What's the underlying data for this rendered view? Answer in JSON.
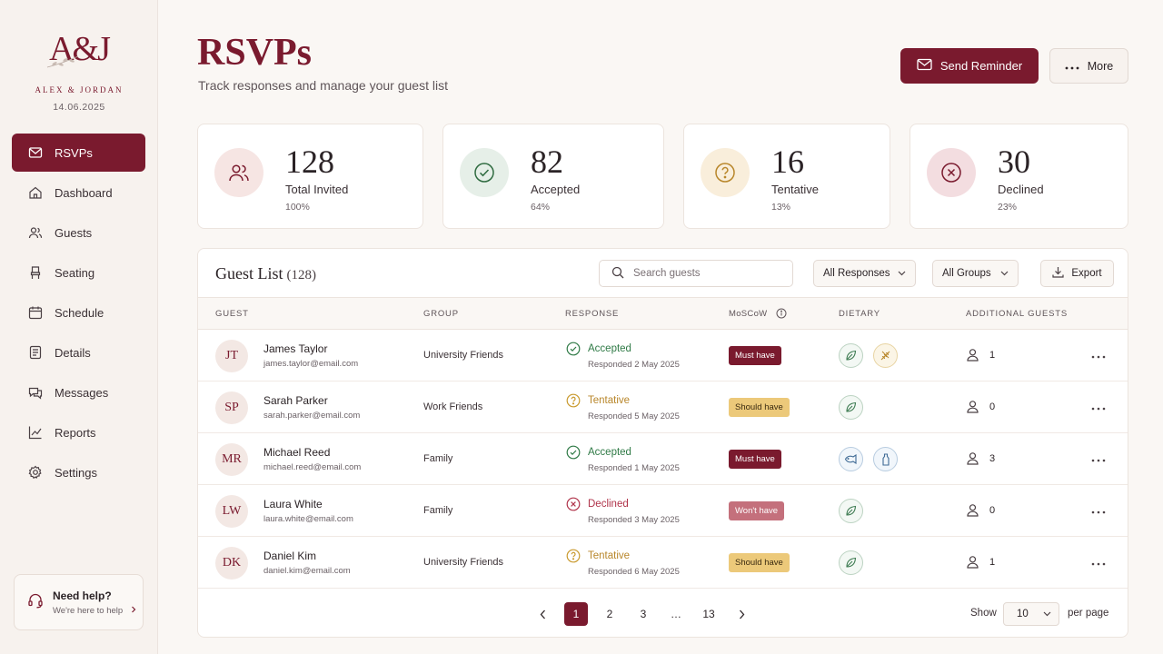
{
  "brand": {
    "monogram": "A&J",
    "names": "ALEX & JORDAN",
    "date": "14.06.2025"
  },
  "nav": [
    {
      "label": "RSVPs",
      "icon": "mail-icon",
      "active": true
    },
    {
      "label": "Dashboard",
      "icon": "home-icon"
    },
    {
      "label": "Guests",
      "icon": "users-icon"
    },
    {
      "label": "Seating",
      "icon": "chair-icon"
    },
    {
      "label": "Schedule",
      "icon": "calendar-icon"
    },
    {
      "label": "Details",
      "icon": "document-icon"
    },
    {
      "label": "Messages",
      "icon": "chat-icon"
    },
    {
      "label": "Reports",
      "icon": "chart-icon"
    },
    {
      "label": "Settings",
      "icon": "gear-icon"
    }
  ],
  "help": {
    "title": "Need help?",
    "subtitle": "We're here to help"
  },
  "header": {
    "title": "RSVPs",
    "subtitle": "Track responses and manage your guest list",
    "send_reminder": "Send Reminder",
    "more": "More"
  },
  "stats": [
    {
      "value": "128",
      "label": "Total Invited",
      "pct": "100%"
    },
    {
      "value": "82",
      "label": "Accepted",
      "pct": "64%"
    },
    {
      "value": "16",
      "label": "Tentative",
      "pct": "13%"
    },
    {
      "value": "30",
      "label": "Declined",
      "pct": "23%"
    }
  ],
  "guest_list": {
    "title": "Guest List",
    "count": "(128)",
    "search_placeholder": "Search guests",
    "filter_responses": "All Responses",
    "filter_groups": "All Groups",
    "export": "Export",
    "columns": [
      "GUEST",
      "GROUP",
      "RESPONSE",
      "MoSCoW",
      "DIETARY",
      "ADDITIONAL GUESTS"
    ],
    "rows": [
      {
        "initials": "JT",
        "name": "James Taylor",
        "email": "james.taylor@email.com",
        "group": "University Friends",
        "response": "Accepted",
        "responded": "Responded 2 May 2025",
        "moscow": "Must have",
        "dietary": [
          "leaf-icon",
          "wheat-icon"
        ],
        "additional": "1"
      },
      {
        "initials": "SP",
        "name": "Sarah Parker",
        "email": "sarah.parker@email.com",
        "group": "Work Friends",
        "response": "Tentative",
        "responded": "Responded 5 May 2025",
        "moscow": "Should have",
        "dietary": [
          "leaf-icon"
        ],
        "additional": "0"
      },
      {
        "initials": "MR",
        "name": "Michael Reed",
        "email": "michael.reed@email.com",
        "group": "Family",
        "response": "Accepted",
        "responded": "Responded 1 May 2025",
        "moscow": "Must have",
        "dietary": [
          "fish-icon",
          "bottle-icon"
        ],
        "additional": "3"
      },
      {
        "initials": "LW",
        "name": "Laura White",
        "email": "laura.white@email.com",
        "group": "Family",
        "response": "Declined",
        "responded": "Responded 3 May 2025",
        "moscow": "Won't have",
        "dietary": [
          "leaf-icon"
        ],
        "additional": "0"
      },
      {
        "initials": "DK",
        "name": "Daniel Kim",
        "email": "daniel.kim@email.com",
        "group": "University Friends",
        "response": "Tentative",
        "responded": "Responded 6 May 2025",
        "moscow": "Should have",
        "dietary": [
          "leaf-icon"
        ],
        "additional": "1"
      }
    ]
  },
  "pagination": {
    "pages": [
      "1",
      "2",
      "3",
      "…",
      "13"
    ],
    "current": "1",
    "show_label": "Show",
    "per_page_value": "10",
    "per_page_label": "per page"
  },
  "colors": {
    "brand": "#7a1a2e",
    "accepted": "#2f7a46",
    "tentative": "#c99a2e",
    "declined": "#b0334a"
  }
}
